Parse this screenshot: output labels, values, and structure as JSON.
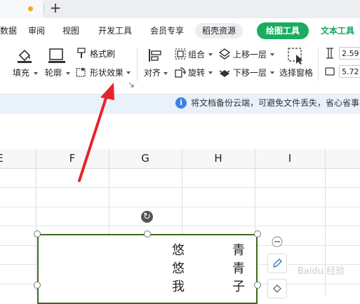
{
  "tab": {
    "status_color": "#f5a623",
    "new_tab_symbol": "+"
  },
  "menu": {
    "items": [
      "数据",
      "审阅",
      "视图",
      "开发工具",
      "会员专享",
      "稻壳资源",
      "绘图工具",
      "文本工具"
    ],
    "active": "绘图工具",
    "accent": "#1aad60"
  },
  "ribbon": {
    "fill": "填充",
    "outline": "轮廓",
    "format_painter": "格式刷",
    "shape_effects": "形状效果",
    "align": "对齐",
    "group": "组合",
    "rotate": "旋转",
    "bring_forward": "上移一层",
    "send_backward": "下移一层",
    "selection_pane": "选择窗格",
    "height_value": "2.59",
    "width_value": "5.72"
  },
  "notification": {
    "text": "将文档备份云端，可避免文件丢失，省心省事",
    "icon": "info-icon"
  },
  "sheet": {
    "columns": [
      "E",
      "F",
      "G",
      "H",
      "I"
    ]
  },
  "shape": {
    "text_col1": [
      "悠",
      "悠",
      "我"
    ],
    "text_col2": [
      "青",
      "青",
      "子"
    ],
    "border_color": "#3c6a1d"
  },
  "annotation": {
    "arrow_color": "#e8242a"
  },
  "watermark": "Baidu 经验"
}
